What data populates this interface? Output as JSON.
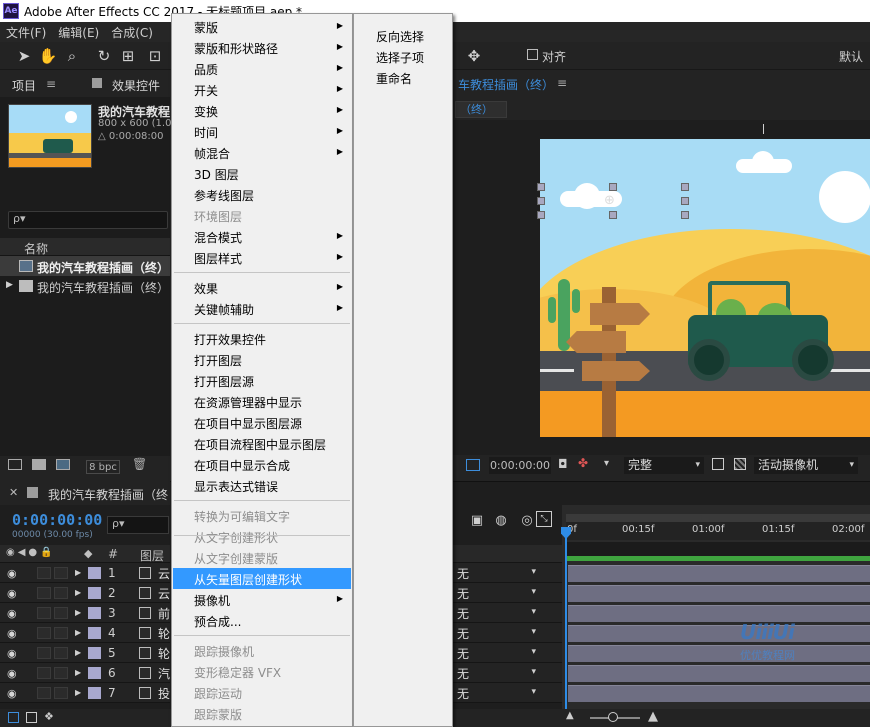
{
  "window": {
    "title": "Adobe After Effects CC 2017 - 无标题项目.aep *",
    "logo_text": "Ae"
  },
  "menubar": {
    "items": [
      "文件(F)",
      "编辑(E)",
      "合成(C)"
    ]
  },
  "toolbar": {
    "snap_label": "对齐",
    "workspace_label": "默认"
  },
  "project_panel": {
    "tab_project": "项目",
    "tab_effects": "效果控件",
    "comp_name": "我的汽车教程",
    "comp_size": "800 x 600 (1.0",
    "comp_duration": "△ 0:00:08:00",
    "search_placeholder": "ρ▾",
    "column_name": "名称",
    "items": [
      {
        "label": "我的汽车教程插画（终）"
      },
      {
        "label": "我的汽车教程插画（终）"
      }
    ],
    "bpc": "8 bpc"
  },
  "viewer": {
    "tab_label": "车教程插画（终）",
    "sub_label": "（终）",
    "timecode": "0:00:00:00",
    "quality": "完整",
    "camera": "活动摄像机"
  },
  "timeline": {
    "tab_label": "我的汽车教程插画（终",
    "timecode": "0:00:00:00",
    "fps": "00000 (30.00 fps)",
    "search_placeholder": "ρ▾",
    "col_hash": "#",
    "col_layer_name": "图层名",
    "layers": [
      {
        "num": "1",
        "name": "云",
        "mode": "无"
      },
      {
        "num": "2",
        "name": "云",
        "mode": "无"
      },
      {
        "num": "3",
        "name": "前",
        "mode": "无"
      },
      {
        "num": "4",
        "name": "轮",
        "mode": "无"
      },
      {
        "num": "5",
        "name": "轮",
        "mode": "无"
      },
      {
        "num": "6",
        "name": "汽",
        "mode": "无"
      },
      {
        "num": "7",
        "name": "投",
        "mode": "无"
      }
    ],
    "ruler_ticks": [
      "0f",
      "00:15f",
      "01:00f",
      "01:15f",
      "02:00f"
    ]
  },
  "context_menu": {
    "items": [
      {
        "label": "蒙版",
        "submenu": true,
        "disabled": false
      },
      {
        "label": "蒙版和形状路径",
        "submenu": true,
        "disabled": false
      },
      {
        "label": "品质",
        "submenu": true,
        "disabled": false
      },
      {
        "label": "开关",
        "submenu": true,
        "disabled": false
      },
      {
        "label": "变换",
        "submenu": true,
        "disabled": false
      },
      {
        "label": "时间",
        "submenu": true,
        "disabled": false
      },
      {
        "label": "帧混合",
        "submenu": true,
        "disabled": false
      },
      {
        "label": "3D 图层",
        "submenu": false,
        "disabled": false
      },
      {
        "label": "参考线图层",
        "submenu": false,
        "disabled": false
      },
      {
        "label": "环境图层",
        "submenu": false,
        "disabled": true
      },
      {
        "label": "混合模式",
        "submenu": true,
        "disabled": false
      },
      {
        "label": "图层样式",
        "submenu": true,
        "disabled": false
      },
      {
        "label": "效果",
        "submenu": true,
        "disabled": false
      },
      {
        "label": "关键帧辅助",
        "submenu": true,
        "disabled": false
      },
      {
        "label": "打开效果控件",
        "submenu": false,
        "disabled": false
      },
      {
        "label": "打开图层",
        "submenu": false,
        "disabled": false
      },
      {
        "label": "打开图层源",
        "submenu": false,
        "disabled": false
      },
      {
        "label": "在资源管理器中显示",
        "submenu": false,
        "disabled": false
      },
      {
        "label": "在项目中显示图层源",
        "submenu": false,
        "disabled": false
      },
      {
        "label": "在项目流程图中显示图层",
        "submenu": false,
        "disabled": false
      },
      {
        "label": "在项目中显示合成",
        "submenu": false,
        "disabled": false
      },
      {
        "label": "显示表达式错误",
        "submenu": false,
        "disabled": false
      },
      {
        "label": "转换为可编辑文字",
        "submenu": false,
        "disabled": true
      },
      {
        "label": "从文字创建形状",
        "submenu": false,
        "disabled": true
      },
      {
        "label": "从文字创建蒙版",
        "submenu": false,
        "disabled": true
      },
      {
        "label": "从矢量图层创建形状",
        "submenu": false,
        "disabled": false,
        "highlighted": true
      },
      {
        "label": "摄像机",
        "submenu": true,
        "disabled": false
      },
      {
        "label": "预合成...",
        "submenu": false,
        "disabled": false
      },
      {
        "label": "跟踪摄像机",
        "submenu": false,
        "disabled": true
      },
      {
        "label": "变形稳定器 VFX",
        "submenu": false,
        "disabled": true
      },
      {
        "label": "跟踪运动",
        "submenu": false,
        "disabled": true
      },
      {
        "label": "跟踪蒙版",
        "submenu": false,
        "disabled": true
      }
    ]
  },
  "submenu": {
    "items": [
      "反向选择",
      "选择子项",
      "重命名"
    ]
  },
  "watermark": {
    "logo": "UiiiUi",
    "text": "优优教程网"
  },
  "colors": {
    "accent_blue": "#3d8ddb",
    "highlight": "#3399ff",
    "menu_bg": "#f0f0f0",
    "panel_bg": "#232323"
  }
}
